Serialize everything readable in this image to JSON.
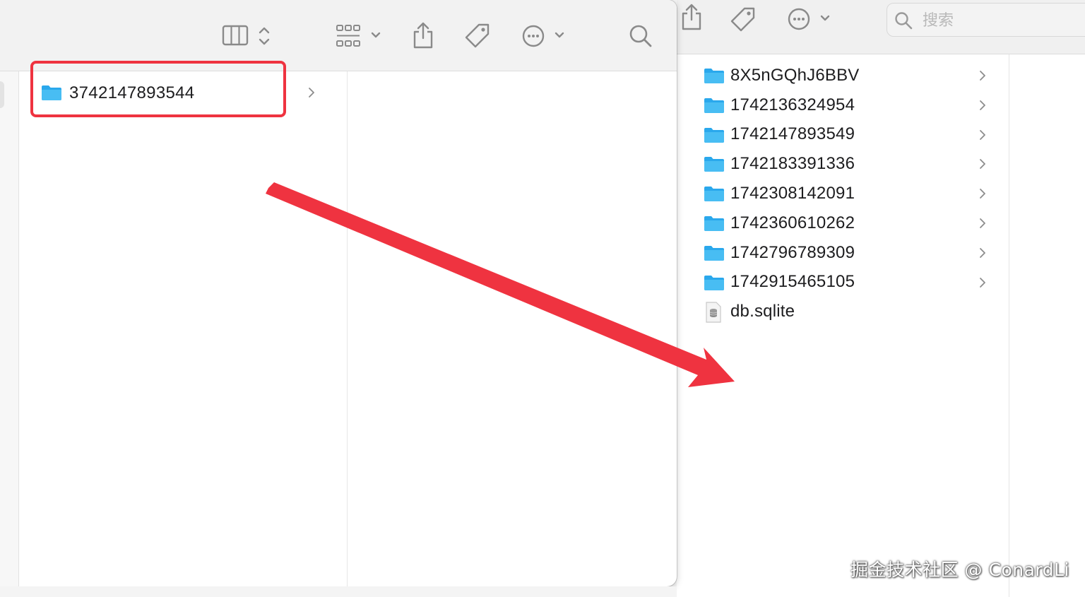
{
  "right_window": {
    "search": {
      "placeholder": "搜索"
    },
    "files": [
      {
        "name": "8X5nGQhJ6BBV",
        "kind": "folder"
      },
      {
        "name": "1742136324954",
        "kind": "folder"
      },
      {
        "name": "1742147893549",
        "kind": "folder"
      },
      {
        "name": "1742183391336",
        "kind": "folder"
      },
      {
        "name": "1742308142091",
        "kind": "folder"
      },
      {
        "name": "1742360610262",
        "kind": "folder"
      },
      {
        "name": "1742796789309",
        "kind": "folder"
      },
      {
        "name": "1742915465105",
        "kind": "folder"
      },
      {
        "name": "db.sqlite",
        "kind": "file"
      }
    ]
  },
  "left_window": {
    "selected_folder": {
      "name": "3742147893544"
    }
  },
  "annotation": {
    "highlight_color": "#ef3340",
    "arrow_color": "#ef3340"
  },
  "watermark": {
    "text": "掘金技术社区 @ ConardLi"
  },
  "colors": {
    "folder_blue": "#2aa8ec",
    "folder_blue_light": "#6fcbf6",
    "icon_gray": "#8a8a8a"
  }
}
